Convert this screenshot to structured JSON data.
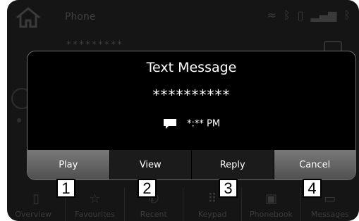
{
  "background": {
    "screen_title": "Phone",
    "number": "*********",
    "tabs": [
      {
        "label": "Overview",
        "icon": "phone-outline-icon"
      },
      {
        "label": "Favourites",
        "icon": "star-icon"
      },
      {
        "label": "Recent",
        "icon": "recent-call-icon"
      },
      {
        "label": "Keypad",
        "icon": "keypad-icon"
      },
      {
        "label": "Phonebook",
        "icon": "phonebook-icon"
      },
      {
        "label": "Messages",
        "icon": "message-icon"
      }
    ]
  },
  "popup": {
    "title": "Text Message",
    "number": "**********",
    "time": "*:** PM",
    "buttons": [
      {
        "label": "Play",
        "highlighted": true
      },
      {
        "label": "View"
      },
      {
        "label": "Reply"
      },
      {
        "label": "Cancel",
        "highlighted": true
      }
    ]
  },
  "callouts": [
    "1",
    "2",
    "3",
    "4"
  ],
  "colors": {
    "background": "#151515",
    "popup": "#000000",
    "button": "#1b1b1b",
    "button_highlight": "#6a6a6a",
    "text": "#ffffff"
  }
}
